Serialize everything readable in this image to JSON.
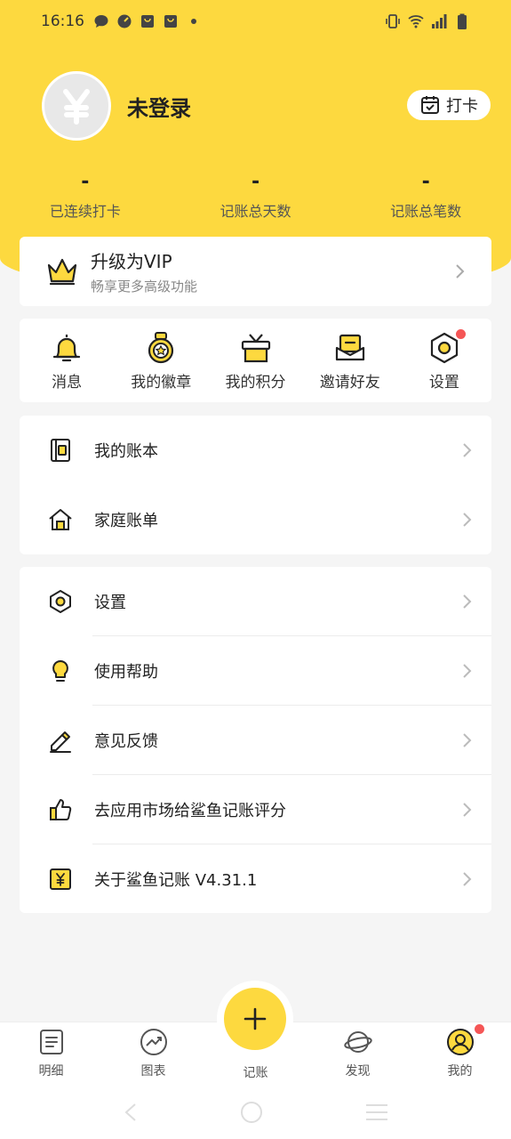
{
  "status_bar": {
    "time": "16:16"
  },
  "profile": {
    "name": "未登录",
    "checkin_label": "打卡",
    "avatar_glyph": "¥"
  },
  "stats": [
    {
      "value": "-",
      "label": "已连续打卡"
    },
    {
      "value": "-",
      "label": "记账总天数"
    },
    {
      "value": "-",
      "label": "记账总笔数"
    }
  ],
  "vip": {
    "title": "升级为VIP",
    "subtitle": "畅享更多高级功能"
  },
  "quick_actions": [
    {
      "label": "消息",
      "icon": "bell-icon"
    },
    {
      "label": "我的徽章",
      "icon": "medal-icon"
    },
    {
      "label": "我的积分",
      "icon": "gift-icon"
    },
    {
      "label": "邀请好友",
      "icon": "envelope-icon"
    },
    {
      "label": "设置",
      "icon": "gear-icon"
    }
  ],
  "list1": [
    {
      "label": "我的账本",
      "icon": "book-icon"
    },
    {
      "label": "家庭账单",
      "icon": "home-icon"
    }
  ],
  "list2": [
    {
      "label": "设置",
      "icon": "gear-icon"
    },
    {
      "label": "使用帮助",
      "icon": "bulb-icon"
    },
    {
      "label": "意见反馈",
      "icon": "pencil-icon"
    },
    {
      "label": "去应用市场给鲨鱼记账评分",
      "icon": "thumbs-up-icon"
    },
    {
      "label": "关于鲨鱼记账 V4.31.1",
      "icon": "yen-icon"
    }
  ],
  "tabbar": [
    {
      "label": "明细",
      "icon": "list-icon"
    },
    {
      "label": "图表",
      "icon": "chart-icon"
    },
    {
      "label": "记账",
      "icon": "plus-icon"
    },
    {
      "label": "发现",
      "icon": "planet-icon"
    },
    {
      "label": "我的",
      "icon": "user-icon"
    }
  ],
  "colors": {
    "accent": "#fdd93f",
    "badge": "#f55656"
  }
}
